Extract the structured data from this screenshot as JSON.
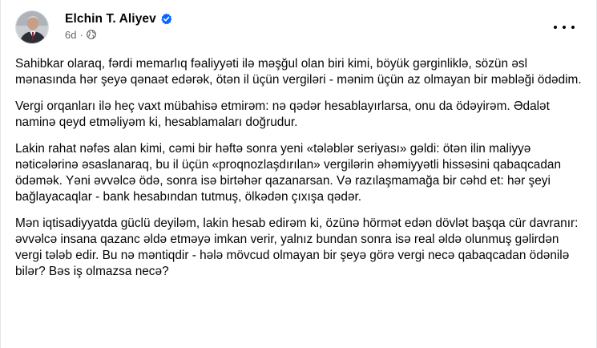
{
  "post": {
    "author": {
      "name": "Elchin T. Aliyev",
      "verified_icon": "verified-badge-icon",
      "time": "6d",
      "separator": "·",
      "privacy_icon": "globe-icon"
    },
    "more_icon": "more-options-icon",
    "paragraphs": [
      "Sahibkar olaraq, fərdi memarlıq fəaliyyəti ilə məşğul olan biri kimi, böyük gərginliklə, sözün əsl mənasında hər şeyə qənaət edərək, ötən il üçün vergiləri - mənim üçün az olmayan bir məbləği ödədim.",
      "Vergi orqanları ilə heç vaxt mübahisə etmirəm: nə qədər hesablayırlarsa, onu da ödəyirəm. Ədalət naminə qeyd etməliyəm ki, hesablamaları doğrudur.",
      "Lakin rahat nəfəs alan kimi, cəmi bir həftə sonra yeni «tələblər seriyası» gəldi: ötən ilin maliyyə nəticələrinə əsaslanaraq, bu il üçün «proqnozlaşdırılan» vergilərin əhəmiyyətli hissəsini qabaqcadan ödəmək. Yəni əvvəlcə ödə, sonra isə birtəhər qazanarsan. Və razılaşmamağa bir cəhd et: hər şeyi bağlayacaqlar - bank hesabından tutmuş, ölkədən çıxışa qədər.",
      "Mən iqtisadiyyatda güclü deyiləm, lakin hesab edirəm ki, özünə hörmət edən dövlət başqa cür davranır: əvvəlcə insana qazanc əldə etməyə imkan verir, yalnız bundan sonra isə real əldə olunmuş gəlirdən vergi tələb edir. Bu nə məntiqdir - hələ mövcud olmayan bir şeyə görə vergi necə qabaqcadan ödənilə bilər? Bəs iş olmazsa necə?"
    ],
    "colors": {
      "text": "#050505",
      "secondary": "#65676b",
      "verified": "#0866ff"
    }
  }
}
